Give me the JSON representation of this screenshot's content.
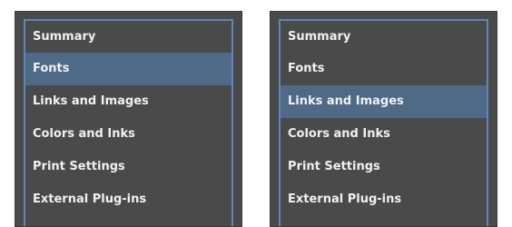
{
  "panels": [
    {
      "selected_index": 1,
      "items": [
        {
          "label": "Summary"
        },
        {
          "label": "Fonts"
        },
        {
          "label": "Links and Images"
        },
        {
          "label": "Colors and Inks"
        },
        {
          "label": "Print Settings"
        },
        {
          "label": "External Plug-ins"
        }
      ]
    },
    {
      "selected_index": 2,
      "items": [
        {
          "label": "Summary"
        },
        {
          "label": "Fonts"
        },
        {
          "label": "Links and Images"
        },
        {
          "label": "Colors and Inks"
        },
        {
          "label": "Print Settings"
        },
        {
          "label": "External Plug-ins"
        }
      ]
    }
  ],
  "colors": {
    "panel_background": "#4a4a4a",
    "list_border": "#5b88ba",
    "selected_row": "#4f6a86",
    "text": "#f0f0f0"
  }
}
